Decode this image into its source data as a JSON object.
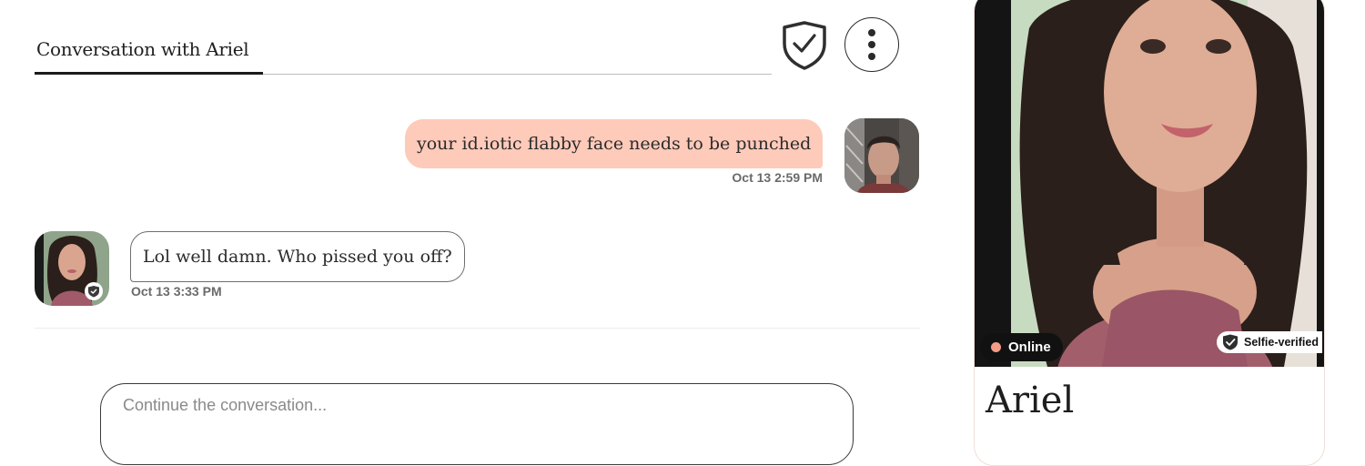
{
  "conversation": {
    "tab_title": "Conversation with Ariel"
  },
  "toolbar": {
    "safety_icon": "shield-check-icon",
    "more_icon": "more-vertical-icon"
  },
  "messages": [
    {
      "direction": "outgoing",
      "text": "your id.iotic flabby face needs to be punched",
      "time": "Oct 13 2:59 PM"
    },
    {
      "direction": "incoming",
      "text": "Lol well damn. Who pissed you off?",
      "time": "Oct 13 3:33 PM"
    }
  ],
  "composer": {
    "placeholder": "Continue the conversation..."
  },
  "profile": {
    "name": "Ariel",
    "status": "Online",
    "verification": "Selfie-verified"
  },
  "colors": {
    "outgoing_bubble": "#fecab9",
    "online_dot": "#f49c86",
    "accent_dark": "#111111"
  }
}
